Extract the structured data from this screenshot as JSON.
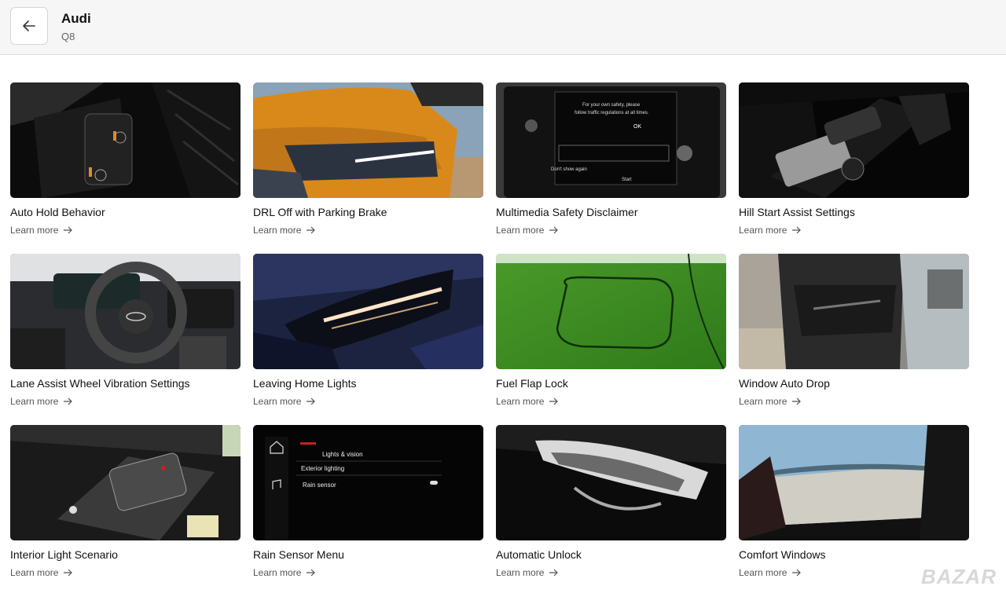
{
  "header": {
    "title": "Audi",
    "subtitle": "Q8"
  },
  "cards": [
    {
      "title": "Auto Hold Behavior",
      "link": "Learn more"
    },
    {
      "title": "DRL Off with Parking Brake",
      "link": "Learn more"
    },
    {
      "title": "Multimedia Safety Disclaimer",
      "link": "Learn more"
    },
    {
      "title": "Hill Start Assist Settings",
      "link": "Learn more"
    },
    {
      "title": "Lane Assist Wheel Vibration Settings",
      "link": "Learn more"
    },
    {
      "title": "Leaving Home Lights",
      "link": "Learn more"
    },
    {
      "title": "Fuel Flap Lock",
      "link": "Learn more"
    },
    {
      "title": "Window Auto Drop",
      "link": "Learn more"
    },
    {
      "title": "Interior Light Scenario",
      "link": "Learn more"
    },
    {
      "title": "Rain Sensor Menu",
      "link": "Learn more"
    },
    {
      "title": "Automatic Unlock",
      "link": "Learn more"
    },
    {
      "title": "Comfort Windows",
      "link": "Learn more"
    }
  ],
  "screen_texts": {
    "disclaimer": [
      "For your own safety, please",
      "follow traffic regulations at all times.",
      "OK",
      "Don't show again",
      "Start"
    ],
    "rain_menu": [
      "Lights & vision",
      "Exterior lighting",
      "Rain sensor"
    ]
  },
  "watermark": "BAZAR"
}
